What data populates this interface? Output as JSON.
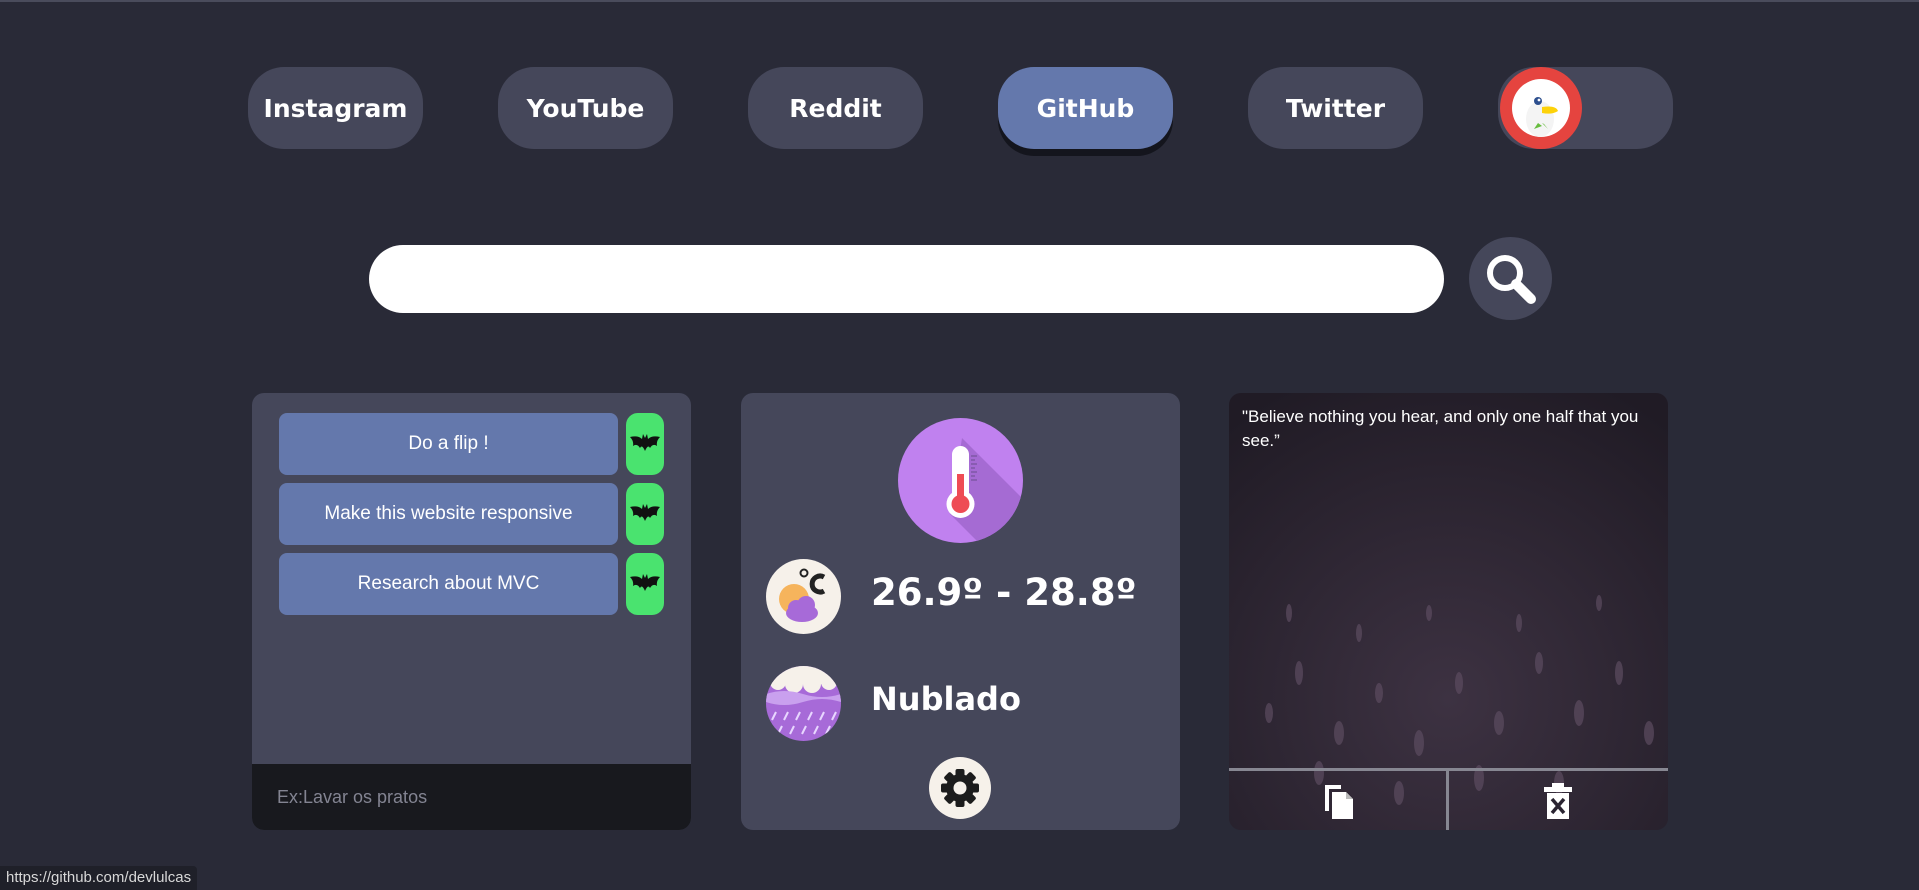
{
  "bookmarks": [
    {
      "label": "Instagram"
    },
    {
      "label": "YouTube"
    },
    {
      "label": "Reddit"
    },
    {
      "label": "GitHub"
    },
    {
      "label": "Twitter"
    },
    {
      "label": "",
      "icon": "duckduckgo-icon"
    }
  ],
  "search": {
    "placeholder": "",
    "icon": "magnifier-icon"
  },
  "todo": {
    "items": [
      {
        "text": "Do a flip !"
      },
      {
        "text": "Make this website responsive"
      },
      {
        "text": "Research about MVC"
      }
    ],
    "delete_icon": "bat-icon",
    "input_placeholder": "Ex:Lavar os pratos"
  },
  "weather": {
    "temp_range": "26.9º - 28.8º",
    "condition": "Nublado",
    "icons": [
      "thermometer-icon",
      "celsius-cloud-icon",
      "rain-cloud-icon",
      "gear-icon"
    ]
  },
  "quote": {
    "text": "\"Believe nothing you hear, and only one half that you see.”",
    "actions": [
      "copy-icon",
      "delete-icon"
    ]
  },
  "status_bar": {
    "url": "https://github.com/devlulcas"
  },
  "colors": {
    "background": "#292a37",
    "button": "#45475a",
    "active_button": "#6478ac",
    "todo_delete": "#4ae36f",
    "duck": "#e5443f"
  }
}
